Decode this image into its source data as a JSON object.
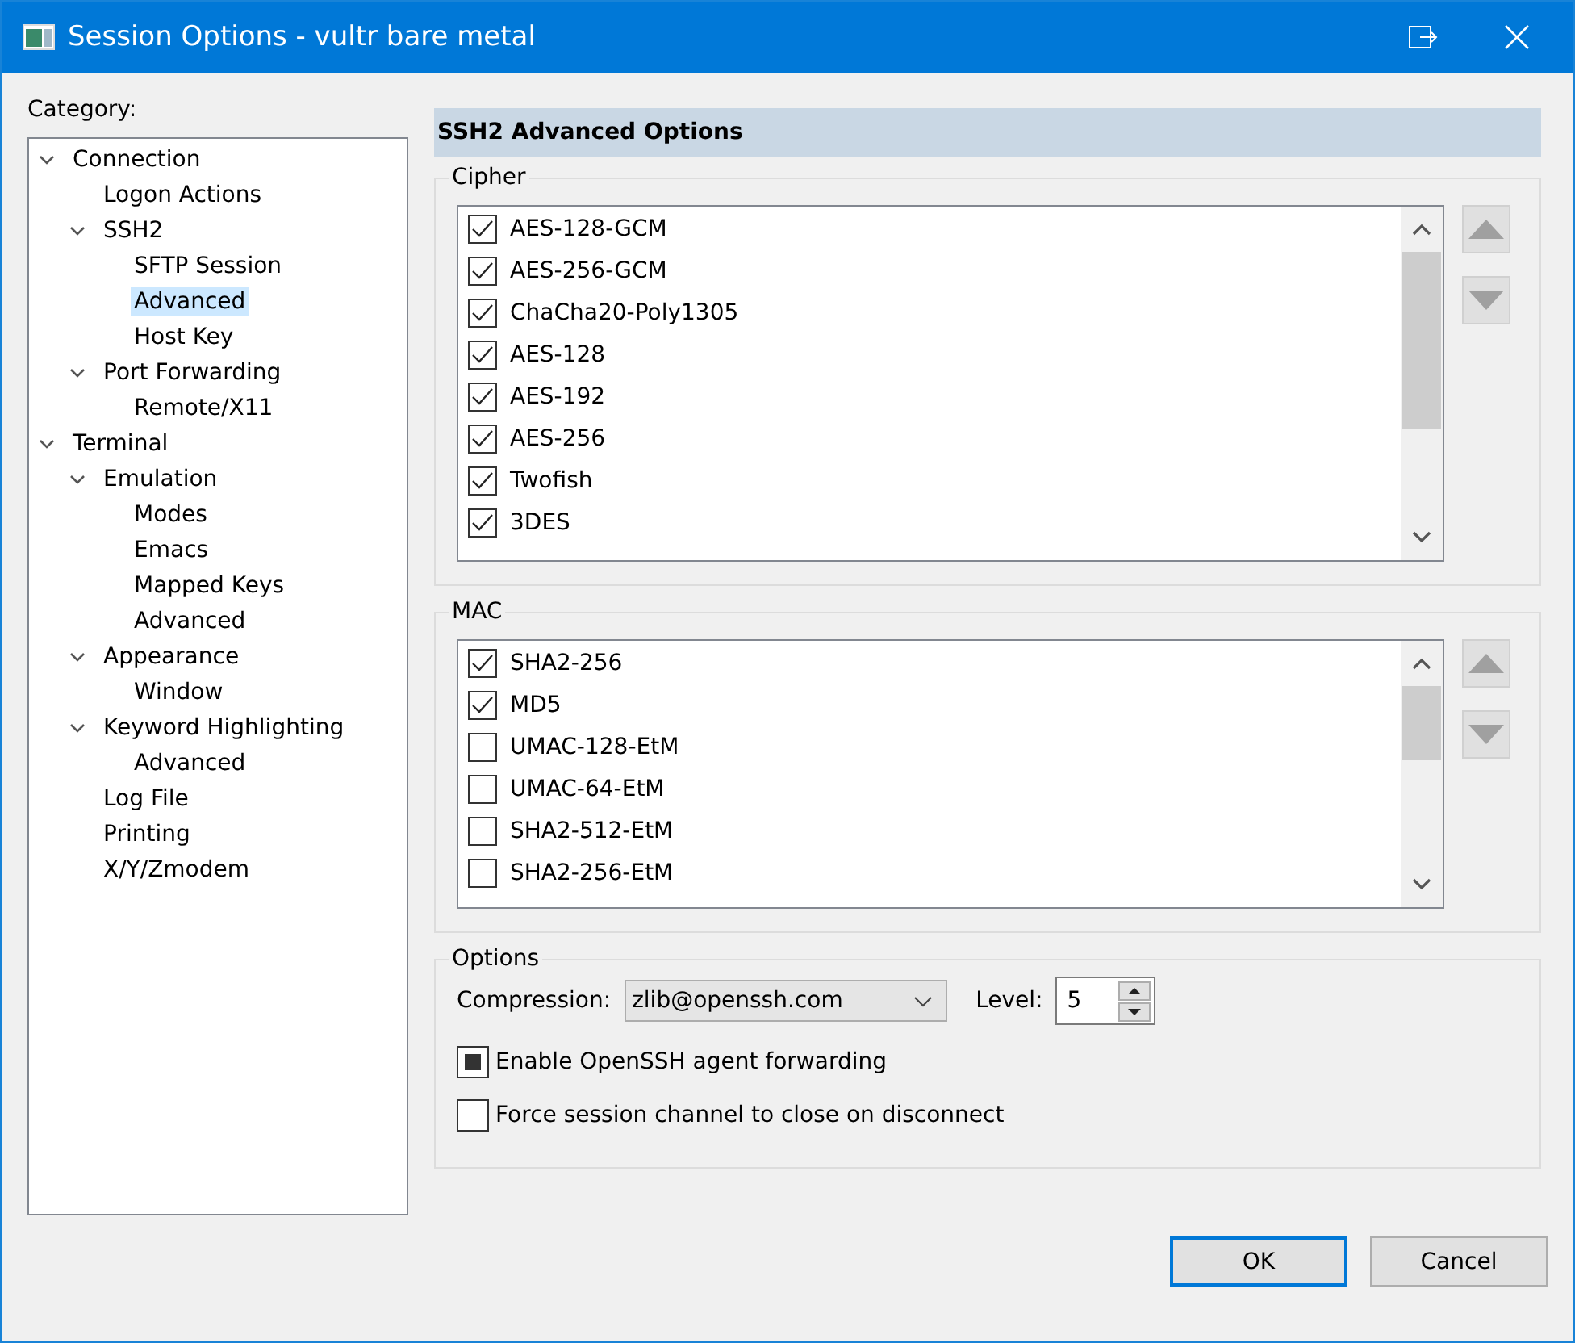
{
  "window": {
    "title": "Session Options - vultr bare metal"
  },
  "category": {
    "label": "Category:",
    "tree": [
      {
        "label": "Connection",
        "expanded": true,
        "selected": false,
        "children": [
          {
            "label": "Logon Actions",
            "selected": false
          },
          {
            "label": "SSH2",
            "expanded": true,
            "selected": false,
            "children": [
              {
                "label": "SFTP Session",
                "selected": false
              },
              {
                "label": "Advanced",
                "selected": true
              },
              {
                "label": "Host Key",
                "selected": false
              }
            ]
          },
          {
            "label": "Port Forwarding",
            "expanded": true,
            "selected": false,
            "children": [
              {
                "label": "Remote/X11",
                "selected": false
              }
            ]
          }
        ]
      },
      {
        "label": "Terminal",
        "expanded": true,
        "selected": false,
        "children": [
          {
            "label": "Emulation",
            "expanded": true,
            "selected": false,
            "children": [
              {
                "label": "Modes",
                "selected": false
              },
              {
                "label": "Emacs",
                "selected": false
              },
              {
                "label": "Mapped Keys",
                "selected": false
              },
              {
                "label": "Advanced",
                "selected": false
              }
            ]
          },
          {
            "label": "Appearance",
            "expanded": true,
            "selected": false,
            "children": [
              {
                "label": "Window",
                "selected": false
              }
            ]
          },
          {
            "label": "Keyword Highlighting",
            "expanded": true,
            "selected": false,
            "children": [
              {
                "label": "Advanced",
                "selected": false
              }
            ]
          },
          {
            "label": "Log File",
            "selected": false
          },
          {
            "label": "Printing",
            "selected": false
          },
          {
            "label": "X/Y/Zmodem",
            "selected": false
          }
        ]
      }
    ]
  },
  "panel": {
    "title": "SSH2 Advanced Options",
    "groups": [
      {
        "label": "Cipher",
        "items": [
          {
            "label": "AES-128-GCM",
            "checked": true
          },
          {
            "label": "AES-256-GCM",
            "checked": true
          },
          {
            "label": "ChaCha20-Poly1305",
            "checked": true
          },
          {
            "label": "AES-128",
            "checked": true
          },
          {
            "label": "AES-192",
            "checked": true
          },
          {
            "label": "AES-256",
            "checked": true
          },
          {
            "label": "Twofish",
            "checked": true
          },
          {
            "label": "3DES",
            "checked": true
          }
        ]
      },
      {
        "label": "MAC",
        "items": [
          {
            "label": "SHA2-256",
            "checked": true
          },
          {
            "label": "MD5",
            "checked": true
          },
          {
            "label": "UMAC-128-EtM",
            "checked": false
          },
          {
            "label": "UMAC-64-EtM",
            "checked": false
          },
          {
            "label": "SHA2-512-EtM",
            "checked": false
          },
          {
            "label": "SHA2-256-EtM",
            "checked": false
          }
        ]
      }
    ],
    "options": {
      "label": "Options",
      "compression_label": "Compression:",
      "compression": "zlib@openssh.com",
      "level_label": "Level:",
      "level_value": "5",
      "checkboxes": [
        {
          "label": "Enable OpenSSH agent forwarding",
          "checked": true
        },
        {
          "label": "Force session channel to close on disconnect",
          "checked": false
        }
      ]
    }
  },
  "buttons": [
    {
      "label": "OK",
      "default": true
    },
    {
      "label": "Cancel",
      "default": false
    }
  ]
}
